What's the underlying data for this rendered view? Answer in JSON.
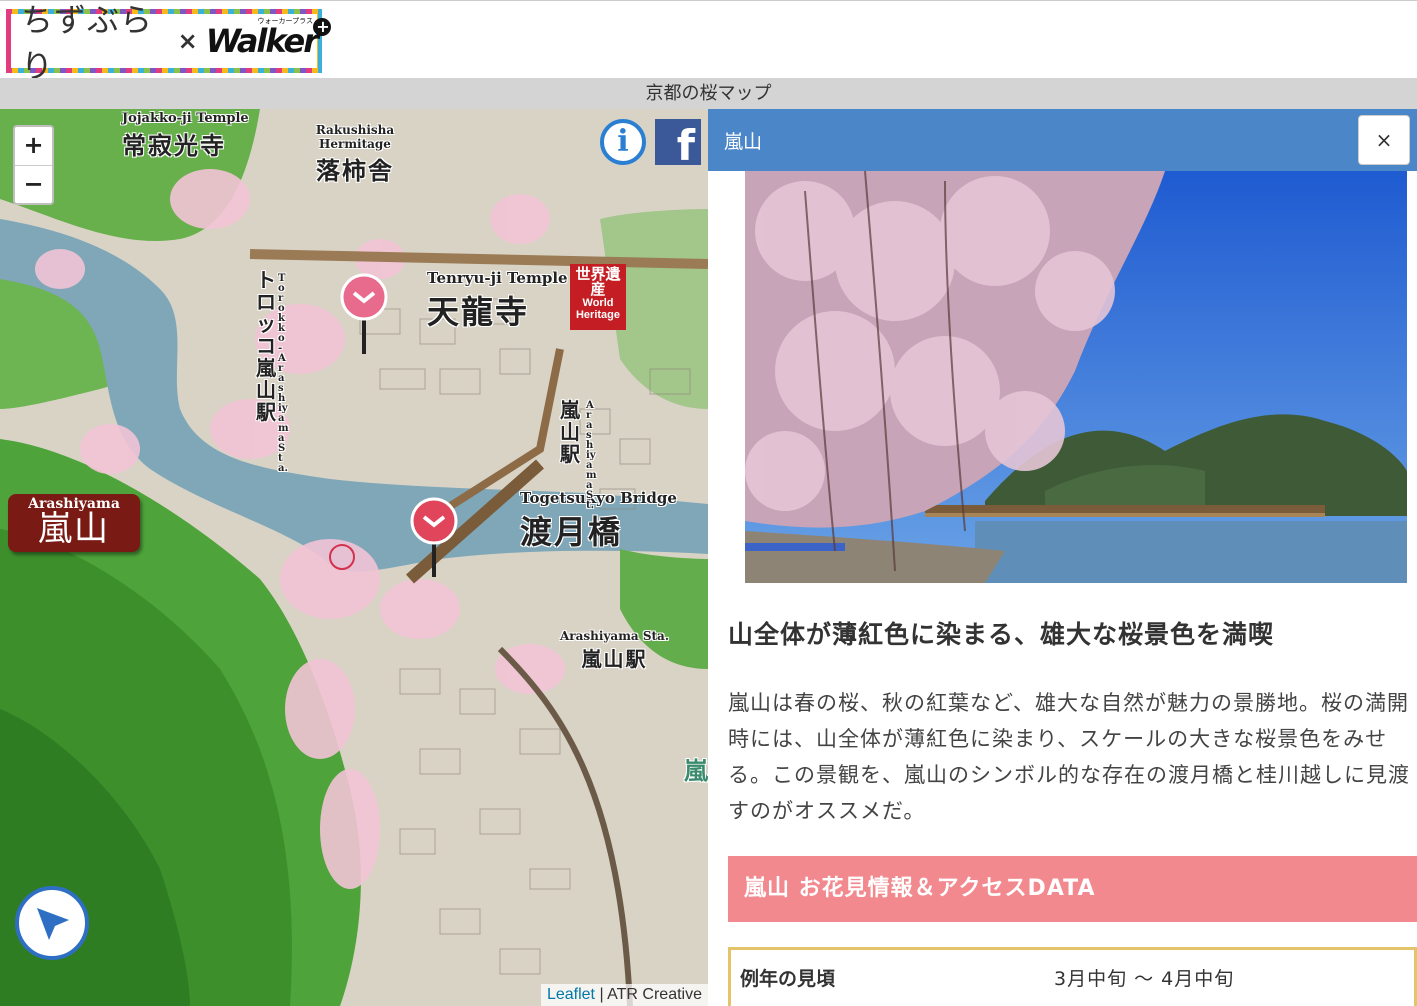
{
  "header": {
    "logo_left": "ちずぶらり",
    "logo_x": "×",
    "logo_right": "Walker",
    "logo_plus": "+",
    "logo_small": "ウォーカープラス"
  },
  "titlebar": {
    "text": "京都の桜マップ"
  },
  "map": {
    "zoom_in": "+",
    "zoom_out": "−",
    "info_icon": "i",
    "facebook_icon": "f",
    "attribution_link": "Leaflet",
    "attribution_rest": " | ATR Creative",
    "labels": {
      "jojakko_en": "Jojakko-ji Temple",
      "jojakko_ja": "常寂光寺",
      "rakushisha_en": "Rakushisha Hermitage",
      "rakushisha_ja": "落柿舎",
      "tenryuji_en": "Tenryu-ji Temple",
      "tenryuji_ja": "天龍寺",
      "heritage_ja": "世界遺産",
      "heritage_en": "World Heritage",
      "togetsukyo_en": "Togetsukyo Bridge",
      "togetsukyo_ja": "渡月橋",
      "arashiyama_sta_en": "Arashiyama Sta.",
      "arashiyama_sta_ja": "嵐山駅",
      "torokko_ja": "トロッコ嵐山駅",
      "torokko_en": "Torokko-Arashiyama Sta.",
      "jr_ja": "嵐山駅",
      "jr_en": "Arashiyama St.",
      "area_ja_fragment": "嵐",
      "badge_en": "Arashiyama",
      "badge_ja": "嵐山"
    }
  },
  "panel": {
    "title": "嵐山",
    "close": "×",
    "headline": "山全体が薄紅色に染まる、雄大な桜景色を満喫",
    "body": "嵐山は春の桜、秋の紅葉など、雄大な自然が魅力の景勝地。桜の満開時には、山全体が薄紅色に染まり、スケールの大きな桜景色をみせる。この景観を、嵐山のシンボル的な存在の渡月橋と桂川越しに見渡すのがオススメだ。",
    "info_header": "嵐山 お花見情報＆アクセスDATA",
    "info_rows": [
      {
        "key": "例年の見頃",
        "value": "3月中旬 〜 4月中旬"
      }
    ]
  },
  "colors": {
    "panel_header": "#4a86c8",
    "info_header": "#f2898f",
    "table_border": "#e3c46a",
    "titlebar": "#d4d4d4"
  }
}
